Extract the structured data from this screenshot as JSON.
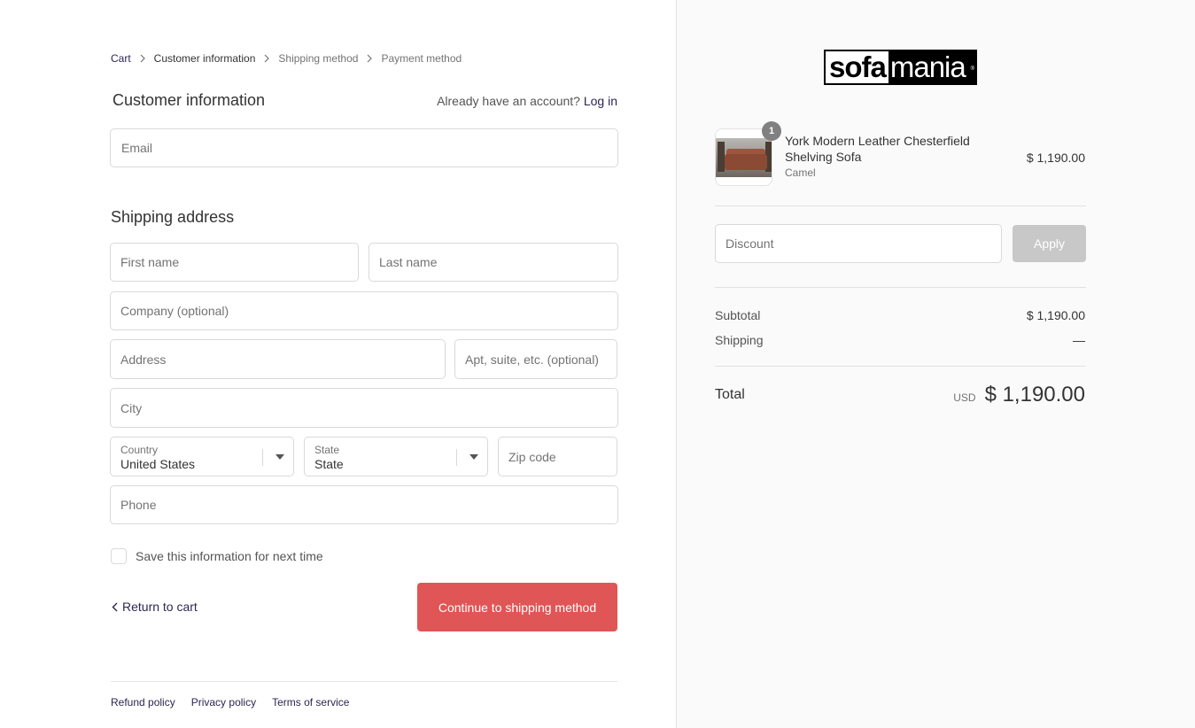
{
  "breadcrumb": {
    "items": [
      "Cart",
      "Customer information",
      "Shipping method",
      "Payment method"
    ]
  },
  "customer": {
    "title": "Customer information",
    "account_prompt": "Already have an account?",
    "login_label": "Log in",
    "email_placeholder": "Email"
  },
  "shipping": {
    "title": "Shipping address",
    "first_name_placeholder": "First name",
    "last_name_placeholder": "Last name",
    "company_placeholder": "Company (optional)",
    "address_placeholder": "Address",
    "apt_placeholder": "Apt, suite, etc. (optional)",
    "city_placeholder": "City",
    "country_label": "Country",
    "country_value": "United States",
    "state_label": "State",
    "state_value": "State",
    "zip_placeholder": "Zip code",
    "phone_placeholder": "Phone",
    "save_info_label": "Save this information for next time"
  },
  "actions": {
    "return_label": "Return to cart",
    "continue_label": "Continue to shipping method"
  },
  "footer": {
    "links": [
      "Refund policy",
      "Privacy policy",
      "Terms of service"
    ]
  },
  "brand": {
    "logo_part1": "sofa",
    "logo_part2": "mania",
    "logo_reg": "®",
    "accent_color": "#e05556",
    "link_color": "#2e2552"
  },
  "order": {
    "item": {
      "quantity": "1",
      "name": "York Modern Leather Chesterfield Shelving Sofa",
      "variant": "Camel",
      "price": "$ 1,190.00"
    },
    "discount_placeholder": "Discount",
    "apply_label": "Apply",
    "subtotal_label": "Subtotal",
    "subtotal_value": "$ 1,190.00",
    "shipping_label": "Shipping",
    "shipping_value": "—",
    "total_label": "Total",
    "total_currency": "USD",
    "total_value": "$ 1,190.00"
  }
}
